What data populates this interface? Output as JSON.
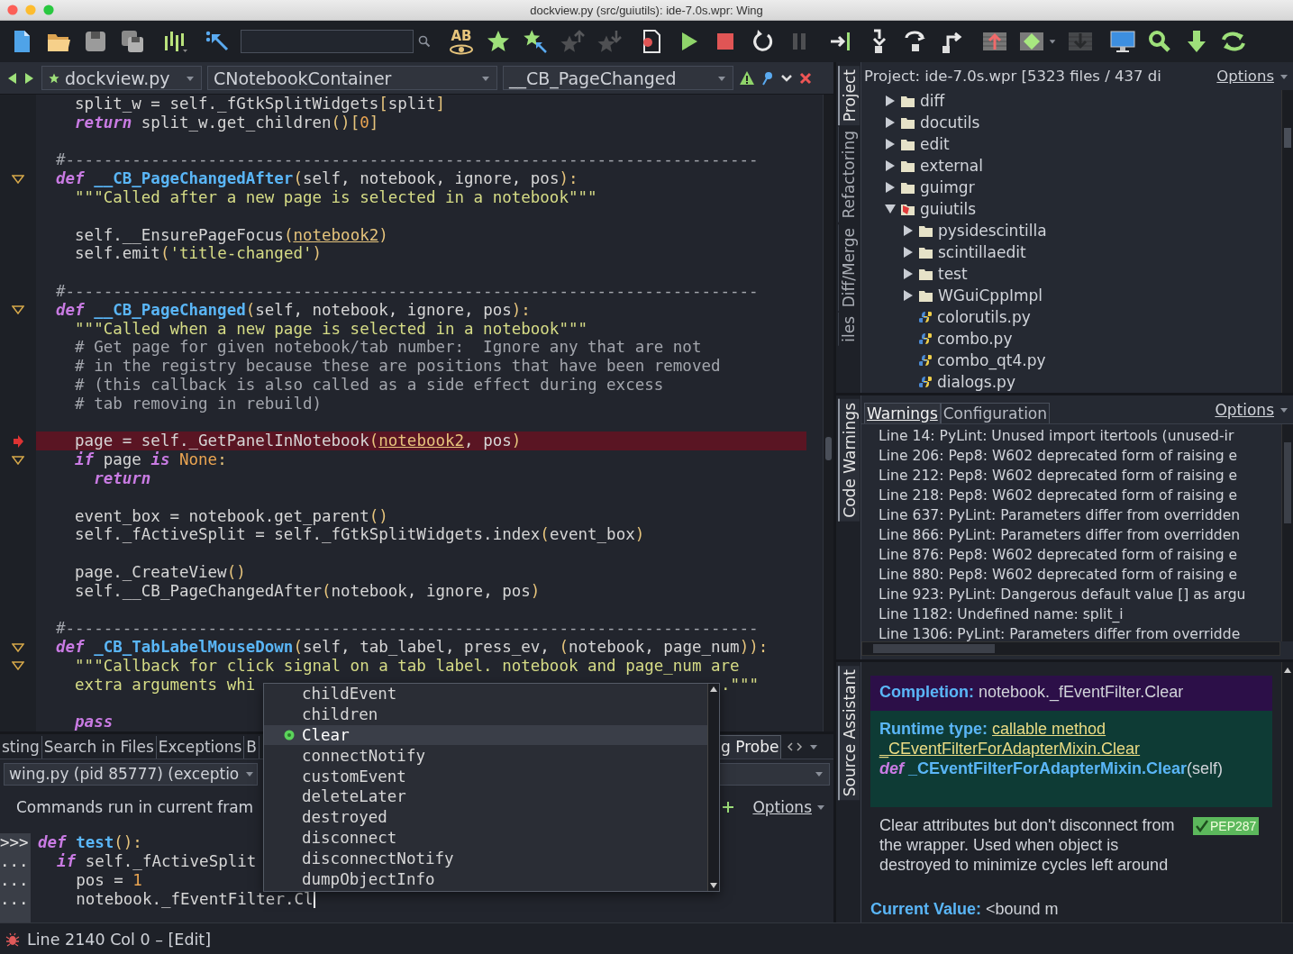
{
  "window": {
    "title": "dockview.py (src/guiutils): ide-7.0s.wpr: Wing"
  },
  "toolbar": [
    {
      "kind": "newfile",
      "disabled": false
    },
    {
      "kind": "open",
      "disabled": false
    },
    {
      "kind": "save",
      "disabled": false
    },
    {
      "kind": "saveall",
      "disabled": false
    },
    {
      "kind": "indent",
      "disabled": false
    },
    {
      "kind": "pointer",
      "disabled": false
    },
    {
      "kind": "search",
      "disabled": false
    },
    {
      "kind": "spell",
      "label": "AB",
      "disabled": false
    },
    {
      "kind": "star",
      "disabled": false
    },
    {
      "kind": "starpick",
      "disabled": false
    },
    {
      "kind": "starup",
      "disabled": true
    },
    {
      "kind": "stardown",
      "disabled": true
    },
    {
      "kind": "record",
      "disabled": false
    },
    {
      "kind": "run",
      "disabled": false
    },
    {
      "kind": "stop",
      "disabled": false
    },
    {
      "kind": "restart",
      "disabled": false
    },
    {
      "kind": "pause",
      "disabled": true
    },
    {
      "kind": "stepinto",
      "disabled": false
    },
    {
      "kind": "stepin",
      "disabled": false
    },
    {
      "kind": "stepover",
      "disabled": false
    },
    {
      "kind": "stepout",
      "disabled": false
    },
    {
      "kind": "stackup",
      "disabled": false
    },
    {
      "kind": "stackmark",
      "disabled": false
    },
    {
      "kind": "stackdown",
      "disabled": true
    },
    {
      "kind": "monitor",
      "disabled": false
    },
    {
      "kind": "find",
      "disabled": false
    },
    {
      "kind": "download",
      "disabled": false
    },
    {
      "kind": "sync",
      "disabled": false
    }
  ],
  "editor": {
    "file": "dockview.py",
    "scope": "CNotebookContainer",
    "method": "__CB_PageChanged",
    "lines": [
      {
        "kind": "code",
        "segs": [
          {
            "text": "  split_w = self._fGtkSplitWidgets",
            "kind": "plain"
          },
          {
            "text": "[",
            "kind": "op"
          },
          {
            "text": "split",
            "kind": "plain"
          },
          {
            "text": "]",
            "kind": "op"
          }
        ]
      },
      {
        "kind": "code",
        "segs": [
          {
            "text": "  return",
            "kind": "kw"
          },
          {
            "text": " split_w.get_children",
            "kind": "plain"
          },
          {
            "text": "()[",
            "kind": "op"
          },
          {
            "text": "0",
            "kind": "num"
          },
          {
            "text": "]",
            "kind": "op"
          }
        ]
      },
      {
        "kind": "blank"
      },
      {
        "kind": "code",
        "segs": [
          {
            "text": "#-------------------------------------------------------------------------",
            "kind": "cmt"
          }
        ]
      },
      {
        "kind": "fold",
        "segs": [
          {
            "text": "def",
            "kind": "kw"
          },
          {
            "text": " __CB_PageChangedAfter",
            "kind": "fn"
          },
          {
            "text": "(",
            "kind": "op"
          },
          {
            "text": "self, notebook, ignore, pos",
            "kind": "plain"
          },
          {
            "text": "):",
            "kind": "op"
          }
        ]
      },
      {
        "kind": "code",
        "segs": [
          {
            "text": "  \"\"\"Called after a new page is selected in a notebook\"\"\"",
            "kind": "str"
          }
        ]
      },
      {
        "kind": "blank"
      },
      {
        "kind": "code",
        "segs": [
          {
            "text": "  self.__EnsurePageFocus",
            "kind": "plain"
          },
          {
            "text": "(",
            "kind": "op"
          },
          {
            "text": "notebook2",
            "kind": "link"
          },
          {
            "text": ")",
            "kind": "op"
          }
        ]
      },
      {
        "kind": "code",
        "segs": [
          {
            "text": "  self.emit",
            "kind": "plain"
          },
          {
            "text": "(",
            "kind": "op"
          },
          {
            "text": "'title-changed'",
            "kind": "str"
          },
          {
            "text": ")",
            "kind": "op"
          }
        ]
      },
      {
        "kind": "blank"
      },
      {
        "kind": "code",
        "segs": [
          {
            "text": "#-------------------------------------------------------------------------",
            "kind": "cmt"
          }
        ]
      },
      {
        "kind": "fold",
        "segs": [
          {
            "text": "def",
            "kind": "kw"
          },
          {
            "text": " __CB_PageChanged",
            "kind": "fn"
          },
          {
            "text": "(",
            "kind": "op"
          },
          {
            "text": "self, notebook, ignore, pos",
            "kind": "plain"
          },
          {
            "text": "):",
            "kind": "op"
          }
        ]
      },
      {
        "kind": "code",
        "segs": [
          {
            "text": "  \"\"\"Called when a new page is selected in a notebook\"\"\"",
            "kind": "str"
          }
        ]
      },
      {
        "kind": "code",
        "segs": [
          {
            "text": "  # Get page for given notebook/tab number:  Ignore any that are not",
            "kind": "cmt"
          }
        ]
      },
      {
        "kind": "code",
        "segs": [
          {
            "text": "  # in the registry because these are positions that have been removed",
            "kind": "cmt"
          }
        ]
      },
      {
        "kind": "code",
        "segs": [
          {
            "text": "  # (this callback is also called as a side effect during excess",
            "kind": "cmt"
          }
        ]
      },
      {
        "kind": "code",
        "segs": [
          {
            "text": "  # tab removing in rebuild)",
            "kind": "cmt"
          }
        ]
      },
      {
        "kind": "blank"
      },
      {
        "kind": "breakpoint",
        "segs": [
          {
            "text": "  page = self._GetPanelInNotebook",
            "kind": "plain"
          },
          {
            "text": "(",
            "kind": "op"
          },
          {
            "text": "notebook2",
            "kind": "link"
          },
          {
            "text": ", pos",
            "kind": "plain"
          },
          {
            "text": ")",
            "kind": "op"
          }
        ]
      },
      {
        "kind": "fold",
        "segs": [
          {
            "text": "  if",
            "kind": "kw"
          },
          {
            "text": " page ",
            "kind": "plain"
          },
          {
            "text": "is",
            "kind": "kw"
          },
          {
            "text": " None",
            "kind": "num"
          },
          {
            "text": ":",
            "kind": "op"
          }
        ]
      },
      {
        "kind": "code",
        "segs": [
          {
            "text": "    return",
            "kind": "kw"
          }
        ]
      },
      {
        "kind": "blank"
      },
      {
        "kind": "code",
        "segs": [
          {
            "text": "  event_box = notebook.get_parent",
            "kind": "plain"
          },
          {
            "text": "()",
            "kind": "op"
          }
        ]
      },
      {
        "kind": "code",
        "segs": [
          {
            "text": "  self._fActiveSplit = self._fGtkSplitWidgets.index",
            "kind": "plain"
          },
          {
            "text": "(",
            "kind": "op"
          },
          {
            "text": "event_box",
            "kind": "plain"
          },
          {
            "text": ")",
            "kind": "op"
          }
        ]
      },
      {
        "kind": "blank"
      },
      {
        "kind": "code",
        "segs": [
          {
            "text": "  page._CreateView",
            "kind": "plain"
          },
          {
            "text": "()",
            "kind": "op"
          }
        ]
      },
      {
        "kind": "code",
        "segs": [
          {
            "text": "  self.__CB_PageChangedAfter",
            "kind": "plain"
          },
          {
            "text": "(",
            "kind": "op"
          },
          {
            "text": "notebook, ignore, pos",
            "kind": "plain"
          },
          {
            "text": ")",
            "kind": "op"
          }
        ]
      },
      {
        "kind": "blank"
      },
      {
        "kind": "code",
        "segs": [
          {
            "text": "#-------------------------------------------------------------------------",
            "kind": "cmt"
          }
        ]
      },
      {
        "kind": "fold",
        "segs": [
          {
            "text": "def",
            "kind": "kw"
          },
          {
            "text": " _CB_TabLabelMouseDown",
            "kind": "fn"
          },
          {
            "text": "(",
            "kind": "op"
          },
          {
            "text": "self, tab_label, press_ev, ",
            "kind": "plain"
          },
          {
            "text": "(",
            "kind": "op"
          },
          {
            "text": "notebook, page_num",
            "kind": "plain"
          },
          {
            "text": ")):",
            "kind": "op"
          }
        ]
      },
      {
        "kind": "fold",
        "segs": [
          {
            "text": "  \"\"\"Callback for click signal on a tab label. notebook and page_num are",
            "kind": "str"
          }
        ]
      },
      {
        "kind": "code",
        "segs": [
          {
            "text": "  extra arguments whi",
            "kind": "str"
          }
        ],
        "tail": ".\"\"\""
      },
      {
        "kind": "blank"
      },
      {
        "kind": "code",
        "segs": [
          {
            "text": "  pass",
            "kind": "kw"
          }
        ]
      }
    ]
  },
  "popup": {
    "items": [
      {
        "label": "childEvent",
        "selected": false
      },
      {
        "label": "children",
        "selected": false
      },
      {
        "label": "Clear",
        "selected": true
      },
      {
        "label": "connectNotify",
        "selected": false
      },
      {
        "label": "customEvent",
        "selected": false
      },
      {
        "label": "deleteLater",
        "selected": false
      },
      {
        "label": "destroyed",
        "selected": false
      },
      {
        "label": "disconnect",
        "selected": false
      },
      {
        "label": "disconnectNotify",
        "selected": false
      },
      {
        "label": "dumpObjectInfo",
        "selected": false
      }
    ]
  },
  "bottom_panel": {
    "tabs": [
      {
        "label": "sting",
        "selected": false
      },
      {
        "label": "Search in Files",
        "selected": false
      },
      {
        "label": "Exceptions",
        "selected": false
      },
      {
        "label": "B",
        "selected": false
      },
      {
        "label": "g Probe",
        "selected": true
      }
    ],
    "process": "wing.py (pid 85777) (exceptio",
    "hint": "Commands run in current fram",
    "options": "Options",
    "console": [
      {
        "prompt": ">>>",
        "segs": [
          {
            "text": "def",
            "kind": "kw"
          },
          {
            "text": " test",
            "kind": "fn"
          },
          {
            "text": "():",
            "kind": "op"
          }
        ]
      },
      {
        "prompt": "...",
        "segs": [
          {
            "text": "  if",
            "kind": "kw"
          },
          {
            "text": " self._fActiveSplit",
            "kind": "plain"
          }
        ]
      },
      {
        "prompt": "...",
        "segs": [
          {
            "text": "    pos = ",
            "kind": "plain"
          },
          {
            "text": "1",
            "kind": "num"
          }
        ]
      },
      {
        "prompt": "...",
        "segs": [
          {
            "text": "    notebook._fEventFilter.Cl",
            "kind": "plain"
          }
        ]
      }
    ]
  },
  "project": {
    "tabs": [
      {
        "label": "Project",
        "selected": true
      },
      {
        "label": "Refactoring",
        "selected": false
      },
      {
        "label": "Diff/Merge",
        "selected": false
      },
      {
        "label": "iles",
        "selected": false
      }
    ],
    "title": "Project: ide-7.0s.wpr [5323 files / 437 di",
    "options": "Options",
    "tree": [
      {
        "label": "diff",
        "kind": "folder",
        "expanded": false
      },
      {
        "label": "docutils",
        "kind": "folder",
        "expanded": false
      },
      {
        "label": "edit",
        "kind": "folder",
        "expanded": false
      },
      {
        "label": "external",
        "kind": "folder",
        "expanded": false
      },
      {
        "label": "guimgr",
        "kind": "folder",
        "expanded": false
      },
      {
        "label": "guiutils",
        "kind": "package",
        "expanded": true,
        "children": [
          {
            "label": "pysidescintilla",
            "kind": "folder",
            "expanded": false
          },
          {
            "label": "scintillaedit",
            "kind": "folder",
            "expanded": false
          },
          {
            "label": "test",
            "kind": "folder",
            "expanded": false
          },
          {
            "label": "WGuiCppImpl",
            "kind": "folder",
            "expanded": false
          },
          {
            "label": "colorutils.py",
            "kind": "file"
          },
          {
            "label": "combo.py",
            "kind": "file"
          },
          {
            "label": "combo_qt4.py",
            "kind": "file"
          },
          {
            "label": "dialogs.py",
            "kind": "file"
          }
        ]
      }
    ]
  },
  "warnings": {
    "side_tabs": [
      {
        "label": "Code Warnings",
        "selected": true
      }
    ],
    "tabs": [
      {
        "label": "Warnings",
        "selected": true
      },
      {
        "label": "Configuration",
        "selected": false
      }
    ],
    "options": "Options",
    "items": [
      "Line 14: PyLint: Unused import itertools (unused-ir",
      "Line 206: Pep8: W602 deprecated form of raising e",
      "Line 212: Pep8: W602 deprecated form of raising e",
      "Line 218: Pep8: W602 deprecated form of raising e",
      "Line 637: PyLint: Parameters differ from overridden",
      "Line 866: PyLint: Parameters differ from overridden",
      "Line 876: Pep8: W602 deprecated form of raising e",
      "Line 880: Pep8: W602 deprecated form of raising e",
      "Line 923: PyLint: Dangerous default value [] as argu",
      "Line 1182: Undefined name: split_i",
      "Line 1306: PyLint: Parameters differ from overridde"
    ]
  },
  "assistant": {
    "side_tabs": [
      {
        "label": "Source Assistant",
        "selected": true
      }
    ],
    "completion_label": "Completion:",
    "completion": "notebook._fEventFilter.Clear",
    "runtime_label": "Runtime type:",
    "runtime_links": [
      "callable method",
      "_CEventFilterForAdapterMixin.Clear"
    ],
    "def_keyword": "def",
    "def_name": "_CEventFilterForAdapterMixin.Clear",
    "def_args": "(self)",
    "doc": "Clear attributes but don't disconnect from the wrapper. Used when object is destroyed to minimize cycles left around",
    "badge": "PEP287",
    "value_label": "Current Value:",
    "value": "<bound m"
  },
  "status_bar": {
    "text": "Line 2140 Col 0 – [Edit]"
  }
}
